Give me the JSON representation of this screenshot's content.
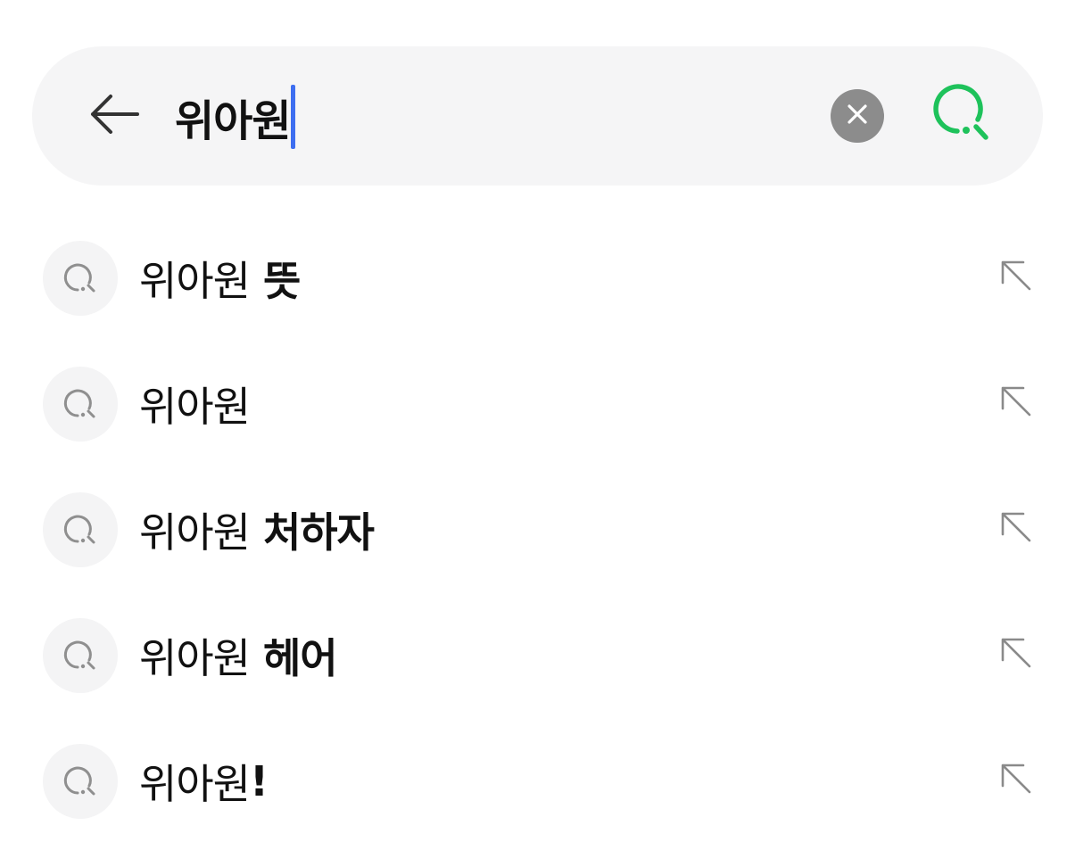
{
  "search": {
    "query": "위아원",
    "caret_color": "#3d6ef0",
    "clear_icon": "close-circle-icon",
    "back_icon": "arrow-left-icon",
    "submit_icon": "search-icon",
    "submit_icon_color": "#1ec25b"
  },
  "suggestions": [
    {
      "base": "위아원",
      "suffix": " 뜻"
    },
    {
      "base": "위아원",
      "suffix": ""
    },
    {
      "base": "위아원",
      "suffix": " 처하자"
    },
    {
      "base": "위아원",
      "suffix": " 헤어"
    },
    {
      "base": "위아원",
      "suffix": "!"
    }
  ],
  "suggestion_icons": {
    "lead": "search-icon",
    "trailing": "arrow-up-left-icon"
  }
}
